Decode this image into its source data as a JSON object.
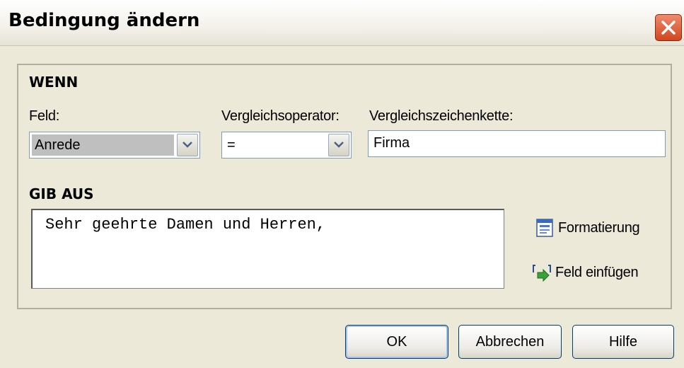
{
  "window": {
    "title": "Bedingung ändern"
  },
  "wenn": {
    "heading": "WENN",
    "feld": {
      "label": "Feld:",
      "value": "Anrede"
    },
    "operator": {
      "label": "Vergleichsoperator:",
      "value": "="
    },
    "zeichenkette": {
      "label": "Vergleichszeichenkette:",
      "value": "Firma"
    }
  },
  "gibaus": {
    "heading": "GIB AUS",
    "text": "Sehr geehrte Damen und Herren,",
    "formatierung_label": "Formatierung",
    "feld_einfuegen_label": "Feld einfügen"
  },
  "buttons": {
    "ok": "OK",
    "abbrechen": "Abbrechen",
    "hilfe": "Hilfe"
  },
  "icons": {
    "close": "close-icon",
    "combo_arrow": "chevron-down-icon",
    "format": "formatting-icon",
    "insert_field": "insert-field-icon"
  },
  "colors": {
    "dialog_bg": "#ece9d8",
    "close_red": "#d2461f",
    "field_border": "#7f9db9",
    "button_border": "#003c74"
  }
}
